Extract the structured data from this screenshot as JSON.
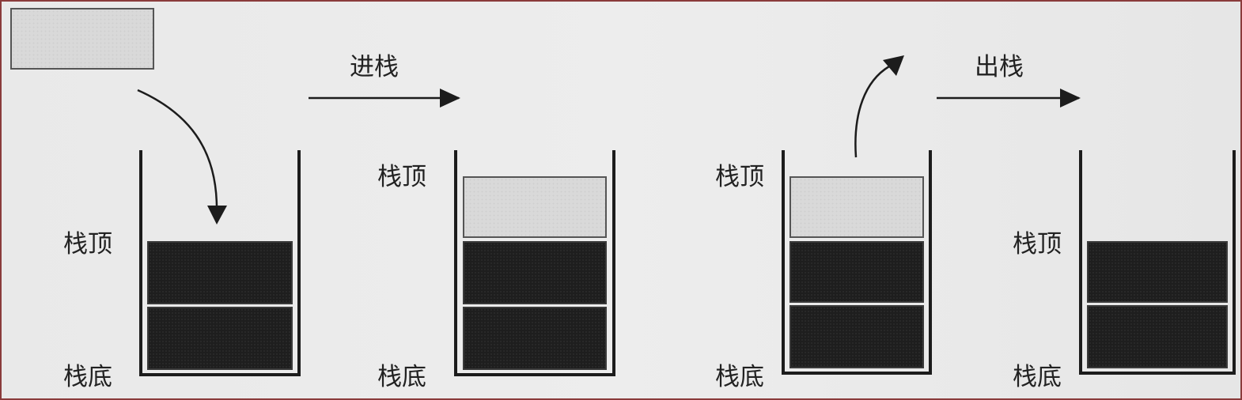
{
  "labels": {
    "push": "进栈",
    "pop": "出栈",
    "stack_top": "栈顶",
    "stack_bottom": "栈底"
  },
  "stacks": [
    {
      "dark_blocks": 2,
      "light_blocks": 0
    },
    {
      "dark_blocks": 2,
      "light_blocks": 1
    },
    {
      "dark_blocks": 2,
      "light_blocks": 1
    },
    {
      "dark_blocks": 2,
      "light_blocks": 0
    }
  ],
  "colors": {
    "dark_block": "#1e1e1e",
    "light_block": "#d9d9d9",
    "frame_border": "#8a3b3b"
  }
}
